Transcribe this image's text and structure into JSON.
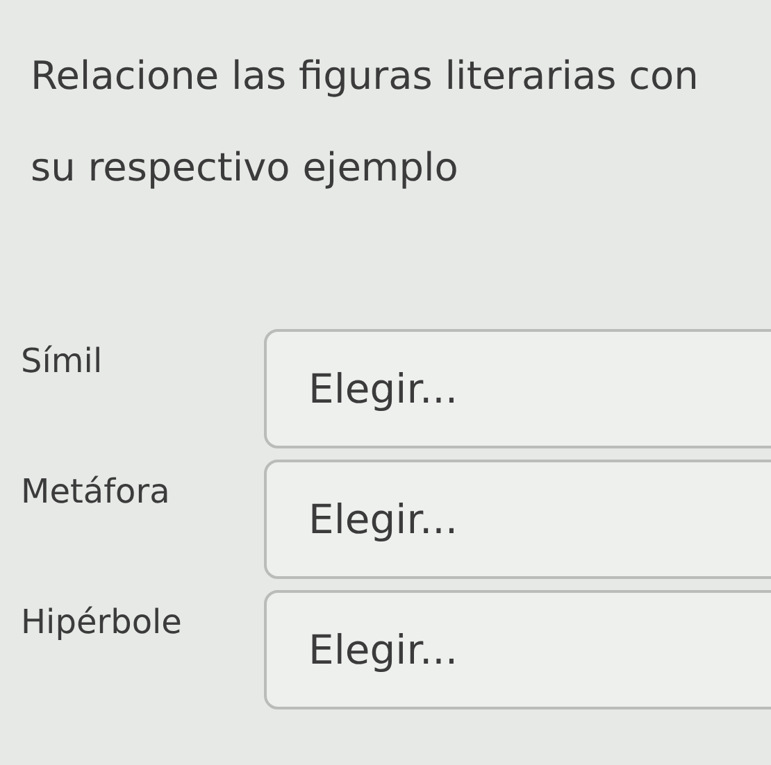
{
  "question": "Relacione las figuras literarias con su respectivo ejemplo",
  "rows": [
    {
      "term": "Símil",
      "choice": "Elegir..."
    },
    {
      "term": "Metáfora",
      "choice": "Elegir..."
    },
    {
      "term": "Hipérbole",
      "choice": "Elegir..."
    }
  ]
}
